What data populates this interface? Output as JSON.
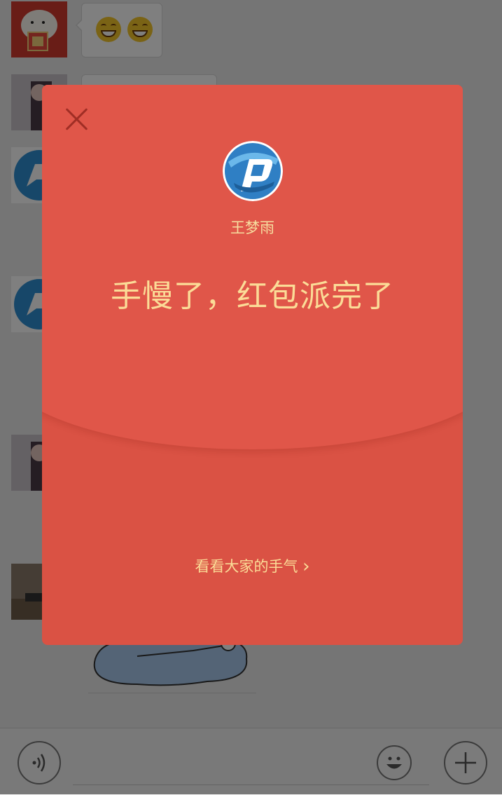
{
  "chat": {
    "messages": [
      {
        "type": "emoji",
        "content": [
          "grin-emoji",
          "grin-emoji"
        ]
      }
    ]
  },
  "toolbar": {
    "voice_icon": "voice-icon",
    "emoji_icon": "smiley-icon",
    "plus_icon": "plus-icon"
  },
  "red_packet": {
    "sender_name": "王梦雨",
    "headline": "手慢了，红包派完了",
    "see_luck_label": "看看大家的手气",
    "arrow": "›",
    "colors": {
      "packet": "#da5244",
      "packet_top": "#e05649",
      "text": "#fbdc97"
    }
  }
}
